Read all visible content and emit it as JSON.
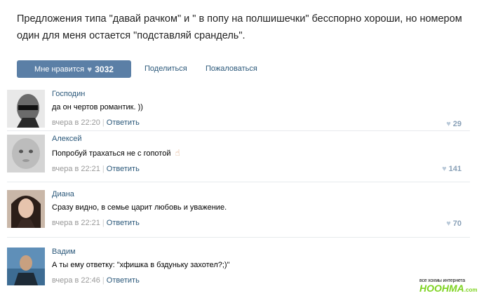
{
  "post": {
    "text": "Предложения типа \"давай рачком\" и \" в попу на полшишечки\" бесспорно хороши, но номером один для меня остается \"подставляй срандель\"."
  },
  "actions": {
    "like_label": "Мне нравится",
    "like_count": "3032",
    "share_label": "Поделиться",
    "report_label": "Пожаловаться"
  },
  "comments": [
    {
      "author": "Господин",
      "text": "да он чертов романтик. ))",
      "time": "вчера в 22:20",
      "reply": "Ответить",
      "likes": "29"
    },
    {
      "author": "Алексей",
      "text": "Попробуй трахаться не с гопотой",
      "time": "вчера в 22:21",
      "reply": "Ответить",
      "likes": "141"
    },
    {
      "author": "Диана",
      "text": "Сразу видно, в семье царит любовь и уважение.",
      "time": "вчера в 22:21",
      "reply": "Ответить",
      "likes": "70"
    },
    {
      "author": "Вадим",
      "text": "А ты ему ответку: \"хфишка в бздуньку захотел?;)\"",
      "time": "вчера в 22:46",
      "reply": "Ответить",
      "likes": ""
    }
  ],
  "watermark": {
    "top": "все хохмы интернета",
    "logo": "HOOHMA",
    "suffix": ".com"
  }
}
